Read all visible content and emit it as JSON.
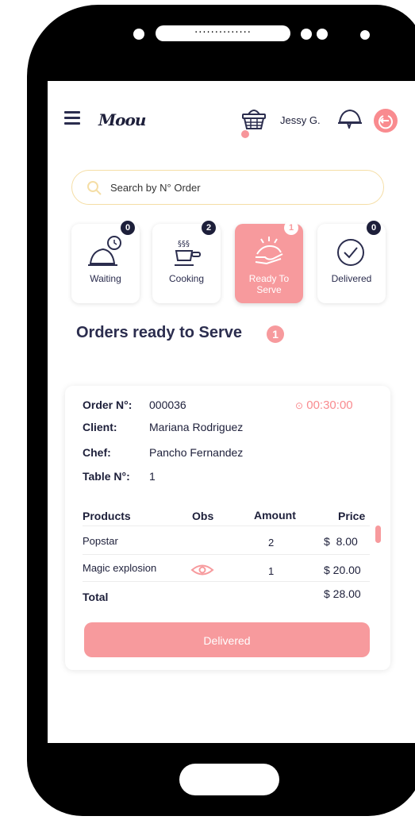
{
  "header": {
    "logo_text": "Moou",
    "user_name": "Jessy G."
  },
  "search": {
    "placeholder": "Search by N° Order"
  },
  "status_tabs": [
    {
      "label": "Waiting",
      "count": "0",
      "icon": "cloche-clock-icon"
    },
    {
      "label": "Cooking",
      "count": "2",
      "icon": "cooking-pot-icon"
    },
    {
      "label": "Ready To Serve",
      "count": "1",
      "icon": "serving-hand-icon",
      "active": true
    },
    {
      "label": "Delivered",
      "count": "0",
      "icon": "check-circle-icon"
    }
  ],
  "section": {
    "title": "Orders ready to Serve",
    "count": "1"
  },
  "order": {
    "order_label": "Order N°:",
    "order_value": "000036",
    "timer": "00:30:00",
    "client_label": "Client:",
    "client_value": "Mariana Rodriguez",
    "chef_label": "Chef:",
    "chef_value": "Pancho Fernandez",
    "table_label": "Table N°:",
    "table_value": "1",
    "columns": {
      "products": "Products",
      "obs": "Obs",
      "amount": "Amount",
      "price": "Price"
    },
    "items": [
      {
        "product": "Popstar",
        "amount": "2",
        "price": "$  8.00"
      },
      {
        "product": "Magic explosion",
        "amount": "1",
        "price": "$ 20.00"
      }
    ],
    "total_label": "Total",
    "total_value": "$ 28.00",
    "button_label": "Delivered"
  },
  "colors": {
    "accent": "#f79a9d",
    "navy": "#1d1f3a",
    "search_border": "#f5dea6"
  }
}
